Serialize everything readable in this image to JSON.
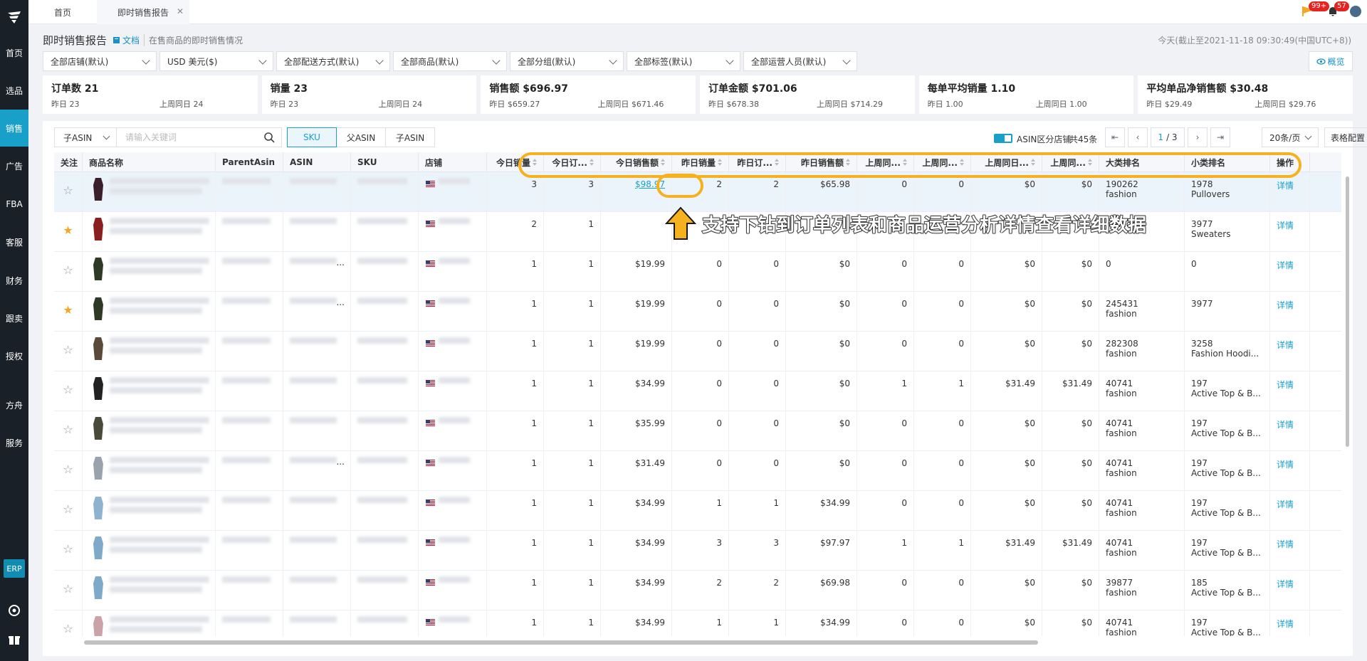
{
  "sidebar": {
    "items": [
      {
        "label": "首页",
        "active": false
      },
      {
        "label": "选品",
        "active": false
      },
      {
        "label": "销售",
        "active": true
      },
      {
        "label": "广告",
        "active": false
      },
      {
        "label": "FBA",
        "active": false
      },
      {
        "label": "客服",
        "active": false
      },
      {
        "label": "财务",
        "active": false
      },
      {
        "label": "跟卖",
        "active": false
      },
      {
        "label": "授权",
        "active": false
      },
      {
        "label": "方舟",
        "active": false
      },
      {
        "label": "服务",
        "active": false
      }
    ],
    "erp_label": "ERP"
  },
  "tabs": [
    {
      "label": "首页"
    },
    {
      "label": "即时销售报告"
    }
  ],
  "top_badges": {
    "flag": "99+",
    "bell": "57"
  },
  "page": {
    "title": "即时销售报告",
    "doc_link": "文档",
    "description": "在售商品的即时销售情况",
    "timestamp": "今天(截止至2021-11-18 09:30:49(中国UTC+8))",
    "overview_btn": "概览"
  },
  "filters": [
    "全部店铺(默认)",
    "USD  美元($)",
    "全部配送方式(默认)",
    "全部商品(默认)",
    "全部分组(默认)",
    "全部标签(默认)",
    "全部运营人员(默认)"
  ],
  "cards": [
    {
      "title": "订单数 21",
      "yesterday": "昨日 23",
      "lastweek": "上周同日 24"
    },
    {
      "title": "销量 23",
      "yesterday": "昨日 23",
      "lastweek": "上周同日 24"
    },
    {
      "title": "销售额 $696.97",
      "yesterday": "昨日 $659.27",
      "lastweek": "上周同日 $671.46"
    },
    {
      "title": "订单金额 $701.06",
      "yesterday": "昨日 $678.38",
      "lastweek": "上周同日 $714.29"
    },
    {
      "title": "每单平均销量 1.10",
      "yesterday": "昨日 1.00",
      "lastweek": "上周同日 1.00"
    },
    {
      "title": "平均单品净销售额 $30.48",
      "yesterday": "昨日 $29.49",
      "lastweek": "上周同日 $29.76"
    }
  ],
  "toolbar": {
    "asin_select": "子ASIN",
    "search_placeholder": "请输入关键词",
    "segments": [
      "SKU",
      "父ASIN",
      "子ASIN"
    ],
    "asin_toggle_label": "ASIN区分店铺",
    "total": "共45条",
    "page_current": "1",
    "page_total": "/ 3",
    "page_size": "20条/页",
    "table_config": "表格配置"
  },
  "columns": [
    "关注",
    "商品名称",
    "ParentAsin",
    "ASIN",
    "SKU",
    "店铺",
    "今日销量",
    "今日订...",
    "今日销售额",
    "昨日销量",
    "昨日订...",
    "昨日销售额",
    "上周同...",
    "上周同...",
    "上周同日...",
    "上周同...",
    "大类排名",
    "小类排名",
    "操作"
  ],
  "rows": [
    {
      "starred": false,
      "today_qty": "3",
      "today_orders": "3",
      "today_sales": "$98.97",
      "y_qty": "2",
      "y_orders": "2",
      "y_sales": "$65.98",
      "lw_qty": "0",
      "lw_orders": "0",
      "lw_sales": "$0",
      "lw_amt": "$0",
      "rank_main": "190262",
      "rank_main_cat": "fashion",
      "rank_sub": "1978",
      "rank_sub_cat": "Pullovers",
      "action": "详情",
      "asin_suffix": "",
      "highlight": true
    },
    {
      "starred": true,
      "today_qty": "2",
      "today_orders": "1",
      "today_sales": "",
      "y_qty": "",
      "y_orders": "",
      "y_sales": "",
      "lw_qty": "",
      "lw_orders": "",
      "lw_sales": "",
      "lw_amt": "",
      "rank_main": "",
      "rank_main_cat": "fashion",
      "rank_sub": "3977",
      "rank_sub_cat": "Sweaters",
      "action": "详情",
      "asin_suffix": "",
      "highlight": false
    },
    {
      "starred": false,
      "today_qty": "1",
      "today_orders": "1",
      "today_sales": "$19.99",
      "y_qty": "0",
      "y_orders": "0",
      "y_sales": "$0",
      "lw_qty": "0",
      "lw_orders": "0",
      "lw_sales": "$0",
      "lw_amt": "$0",
      "rank_main": "0",
      "rank_main_cat": "",
      "rank_sub": "0",
      "rank_sub_cat": "",
      "action": "详情",
      "asin_suffix": "...",
      "highlight": false
    },
    {
      "starred": true,
      "today_qty": "1",
      "today_orders": "1",
      "today_sales": "$19.99",
      "y_qty": "0",
      "y_orders": "0",
      "y_sales": "$0",
      "lw_qty": "0",
      "lw_orders": "0",
      "lw_sales": "$0",
      "lw_amt": "$0",
      "rank_main": "245431",
      "rank_main_cat": "fashion",
      "rank_sub": "3977",
      "rank_sub_cat": "",
      "action": "详情",
      "asin_suffix": "...",
      "highlight": false
    },
    {
      "starred": false,
      "today_qty": "1",
      "today_orders": "1",
      "today_sales": "$19.99",
      "y_qty": "0",
      "y_orders": "0",
      "y_sales": "$0",
      "lw_qty": "0",
      "lw_orders": "0",
      "lw_sales": "$0",
      "lw_amt": "$0",
      "rank_main": "282308",
      "rank_main_cat": "fashion",
      "rank_sub": "3258",
      "rank_sub_cat": "Fashion Hoodi...",
      "action": "详情",
      "asin_suffix": "",
      "highlight": false
    },
    {
      "starred": false,
      "today_qty": "1",
      "today_orders": "1",
      "today_sales": "$34.99",
      "y_qty": "0",
      "y_orders": "0",
      "y_sales": "$0",
      "lw_qty": "1",
      "lw_orders": "1",
      "lw_sales": "$31.49",
      "lw_amt": "$31.49",
      "rank_main": "40741",
      "rank_main_cat": "fashion",
      "rank_sub": "197",
      "rank_sub_cat": "Active Top & B...",
      "action": "详情",
      "asin_suffix": "",
      "highlight": false
    },
    {
      "starred": false,
      "today_qty": "1",
      "today_orders": "1",
      "today_sales": "$35.99",
      "y_qty": "0",
      "y_orders": "0",
      "y_sales": "$0",
      "lw_qty": "0",
      "lw_orders": "0",
      "lw_sales": "$0",
      "lw_amt": "$0",
      "rank_main": "40741",
      "rank_main_cat": "fashion",
      "rank_sub": "197",
      "rank_sub_cat": "Active Top & B...",
      "action": "详情",
      "asin_suffix": "",
      "highlight": false
    },
    {
      "starred": false,
      "today_qty": "1",
      "today_orders": "1",
      "today_sales": "$31.49",
      "y_qty": "0",
      "y_orders": "0",
      "y_sales": "$0",
      "lw_qty": "0",
      "lw_orders": "0",
      "lw_sales": "$0",
      "lw_amt": "$0",
      "rank_main": "40741",
      "rank_main_cat": "fashion",
      "rank_sub": "197",
      "rank_sub_cat": "Active Top & B...",
      "action": "详情",
      "asin_suffix": "...",
      "highlight": false
    },
    {
      "starred": false,
      "today_qty": "1",
      "today_orders": "1",
      "today_sales": "$34.99",
      "y_qty": "1",
      "y_orders": "1",
      "y_sales": "$34.99",
      "lw_qty": "0",
      "lw_orders": "0",
      "lw_sales": "$0",
      "lw_amt": "$0",
      "rank_main": "40741",
      "rank_main_cat": "fashion",
      "rank_sub": "197",
      "rank_sub_cat": "Active Top & B...",
      "action": "详情",
      "asin_suffix": "",
      "highlight": false
    },
    {
      "starred": false,
      "today_qty": "1",
      "today_orders": "1",
      "today_sales": "$34.99",
      "y_qty": "3",
      "y_orders": "3",
      "y_sales": "$97.97",
      "lw_qty": "1",
      "lw_orders": "1",
      "lw_sales": "$31.49",
      "lw_amt": "$31.49",
      "rank_main": "40741",
      "rank_main_cat": "fashion",
      "rank_sub": "197",
      "rank_sub_cat": "Active Top & B...",
      "action": "详情",
      "asin_suffix": "",
      "highlight": false
    },
    {
      "starred": false,
      "today_qty": "1",
      "today_orders": "1",
      "today_sales": "$34.99",
      "y_qty": "2",
      "y_orders": "2",
      "y_sales": "$69.98",
      "lw_qty": "0",
      "lw_orders": "0",
      "lw_sales": "$0",
      "lw_amt": "$0",
      "rank_main": "39877",
      "rank_main_cat": "fashion",
      "rank_sub": "185",
      "rank_sub_cat": "Active Top & B...",
      "action": "详情",
      "asin_suffix": "",
      "highlight": false
    },
    {
      "starred": false,
      "today_qty": "1",
      "today_orders": "1",
      "today_sales": "$34.99",
      "y_qty": "1",
      "y_orders": "1",
      "y_sales": "$34.99",
      "lw_qty": "0",
      "lw_orders": "0",
      "lw_sales": "$0",
      "lw_amt": "$0",
      "rank_main": "40741",
      "rank_main_cat": "fashion",
      "rank_sub": "197",
      "rank_sub_cat": "Active Top & B...",
      "action": "详情",
      "asin_suffix": "",
      "highlight": false
    }
  ],
  "annotation": {
    "text": "支持下钻到订单列表和商品运营分析详情查看详细数据",
    "color": "#f6b21e"
  },
  "colors": {
    "accent": "#18a0c9",
    "sidebar": "#1a2028",
    "star": "#f5a623"
  }
}
